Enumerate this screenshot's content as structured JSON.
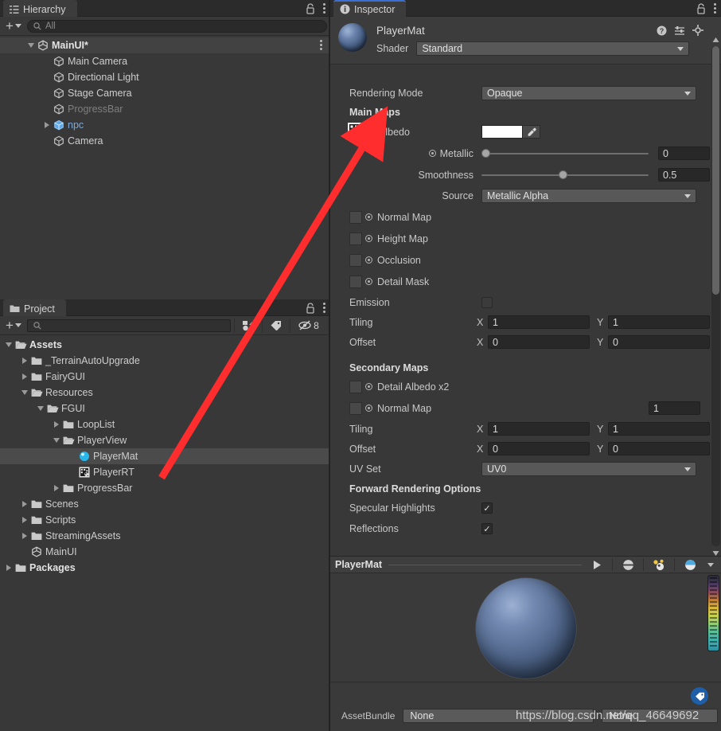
{
  "hierarchy": {
    "tab_label": "Hierarchy",
    "tab_icon": "hierarchy-icon",
    "lock_icon": "lock-icon",
    "menu_icon": "kebab-menu-icon",
    "add_label": "+",
    "search_placeholder": "All",
    "search_value": "",
    "items": [
      {
        "label": "MainUI*",
        "icon": "unity-scene-icon",
        "depth": 1,
        "expanded": true,
        "has_arrow": true,
        "style": "bold",
        "selected_row": true
      },
      {
        "label": "Main Camera",
        "icon": "gameobject-cube-icon",
        "depth": 2,
        "has_arrow": false,
        "style": "normal"
      },
      {
        "label": "Directional Light",
        "icon": "gameobject-cube-icon",
        "depth": 2,
        "has_arrow": false,
        "style": "normal"
      },
      {
        "label": "Stage Camera",
        "icon": "gameobject-cube-icon",
        "depth": 2,
        "has_arrow": false,
        "style": "normal"
      },
      {
        "label": "ProgressBar",
        "icon": "gameobject-cube-icon",
        "depth": 2,
        "has_arrow": false,
        "style": "disabled"
      },
      {
        "label": "npc",
        "icon": "prefab-cube-icon",
        "depth": 2,
        "has_arrow": true,
        "expanded": false,
        "style": "prefab"
      },
      {
        "label": "Camera",
        "icon": "gameobject-cube-icon",
        "depth": 2,
        "has_arrow": false,
        "style": "normal"
      }
    ]
  },
  "project": {
    "tab_label": "Project",
    "tab_icon": "folder-icon",
    "lock_icon": "lock-icon",
    "menu_icon": "kebab-menu-icon",
    "add_label": "+",
    "search_placeholder": "",
    "search_value": "",
    "filter_type_icon": "filter-by-type-icon",
    "filter_label_icon": "filter-by-label-icon",
    "hidden_count": "8",
    "hidden_icon": "hidden-packages-icon",
    "items": [
      {
        "label": "Assets",
        "icon": "folder-open-icon",
        "depth": 0,
        "has_arrow": true,
        "expanded": true,
        "style": "bold"
      },
      {
        "label": "_TerrainAutoUpgrade",
        "icon": "folder-icon",
        "depth": 1,
        "has_arrow": true,
        "expanded": false,
        "style": "normal"
      },
      {
        "label": "FairyGUI",
        "icon": "folder-icon",
        "depth": 1,
        "has_arrow": true,
        "expanded": false,
        "style": "normal"
      },
      {
        "label": "Resources",
        "icon": "folder-open-icon",
        "depth": 1,
        "has_arrow": true,
        "expanded": true,
        "style": "normal"
      },
      {
        "label": "FGUI",
        "icon": "folder-open-icon",
        "depth": 2,
        "has_arrow": true,
        "expanded": true,
        "style": "normal"
      },
      {
        "label": "LoopList",
        "icon": "folder-icon",
        "depth": 3,
        "has_arrow": true,
        "expanded": false,
        "style": "normal"
      },
      {
        "label": "PlayerView",
        "icon": "folder-open-icon",
        "depth": 3,
        "has_arrow": true,
        "expanded": true,
        "style": "normal"
      },
      {
        "label": "PlayerMat",
        "icon": "material-sphere-icon",
        "depth": 4,
        "has_arrow": false,
        "style": "normal",
        "selected": true
      },
      {
        "label": "PlayerRT",
        "icon": "rendertexture-icon",
        "depth": 4,
        "has_arrow": false,
        "style": "normal"
      },
      {
        "label": "ProgressBar",
        "icon": "folder-icon",
        "depth": 3,
        "has_arrow": true,
        "expanded": false,
        "style": "normal"
      },
      {
        "label": "Scenes",
        "icon": "folder-icon",
        "depth": 1,
        "has_arrow": true,
        "expanded": false,
        "style": "normal"
      },
      {
        "label": "Scripts",
        "icon": "folder-icon",
        "depth": 1,
        "has_arrow": true,
        "expanded": false,
        "style": "normal"
      },
      {
        "label": "StreamingAssets",
        "icon": "folder-icon",
        "depth": 1,
        "has_arrow": true,
        "expanded": false,
        "style": "normal"
      },
      {
        "label": "MainUI",
        "icon": "unity-scene-icon",
        "depth": 1,
        "has_arrow": false,
        "style": "normal"
      },
      {
        "label": "Packages",
        "icon": "folder-icon",
        "depth": 0,
        "has_arrow": true,
        "expanded": false,
        "style": "bold"
      }
    ]
  },
  "inspector": {
    "tab_label": "Inspector",
    "tab_icon": "info-icon",
    "lock_icon": "lock-icon",
    "menu_icon": "kebab-menu-icon",
    "asset_name": "PlayerMat",
    "asset_icon": "material-sphere-icon",
    "help_icon": "help-icon",
    "preset_icon": "preset-icon",
    "settings_icon": "gear-icon",
    "shader_label": "Shader",
    "shader_value": "Standard",
    "rendering_mode_label": "Rendering Mode",
    "rendering_mode_value": "Opaque",
    "main_maps_header": "Main Maps",
    "albedo_label": "Albedo",
    "albedo_color": "#ffffff",
    "albedo_texture_icon": "rendertexture-icon",
    "eyedropper_icon": "eyedropper-icon",
    "metallic_label": "Metallic",
    "metallic_value": "0",
    "metallic_fraction": 0.0,
    "smoothness_label": "Smoothness",
    "smoothness_value": "0.5",
    "smoothness_fraction": 0.5,
    "source_label": "Source",
    "source_value": "Metallic Alpha",
    "normal_map_label": "Normal Map",
    "height_map_label": "Height Map",
    "occlusion_label": "Occlusion",
    "detail_mask_label": "Detail Mask",
    "emission_label": "Emission",
    "emission_checked": false,
    "tiling_label": "Tiling",
    "tiling_x": "1",
    "tiling_y": "1",
    "offset_label": "Offset",
    "offset_x": "0",
    "offset_y": "0",
    "secondary_maps_header": "Secondary Maps",
    "detail_albedo_label": "Detail Albedo x2",
    "secondary_normal_label": "Normal Map",
    "secondary_normal_value": "1",
    "sec_tiling_label": "Tiling",
    "sec_tiling_x": "1",
    "sec_tiling_y": "1",
    "sec_offset_label": "Offset",
    "sec_offset_x": "0",
    "sec_offset_y": "0",
    "uv_set_label": "UV Set",
    "uv_set_value": "UV0",
    "forward_header": "Forward Rendering Options",
    "specular_label": "Specular Highlights",
    "specular_checked": true,
    "reflections_label": "Reflections",
    "reflections_checked": true,
    "axis_x": "X",
    "axis_y": "Y",
    "check_glyph": "✓"
  },
  "preview": {
    "title": "PlayerMat",
    "play_icon": "play-icon",
    "shading_icon": "lighting-sphere-icon",
    "light_icon": "light-settings-icon",
    "material_icon": "preview-sphere-icon",
    "dropdown_icon": "chevron-down-icon",
    "gradient_icon": "exposure-gradient-slider"
  },
  "footer": {
    "assetbundle_label": "AssetBundle",
    "assetbundle_value": "None",
    "assetbundle_variant": "None",
    "tag_icon": "asset-label-icon"
  },
  "watermark": {
    "text": "https://blog.csdn.net/qq_46649692"
  },
  "annotation": {
    "arrow_color": "#ff2d2d",
    "name": "red-arrow-annotation"
  }
}
